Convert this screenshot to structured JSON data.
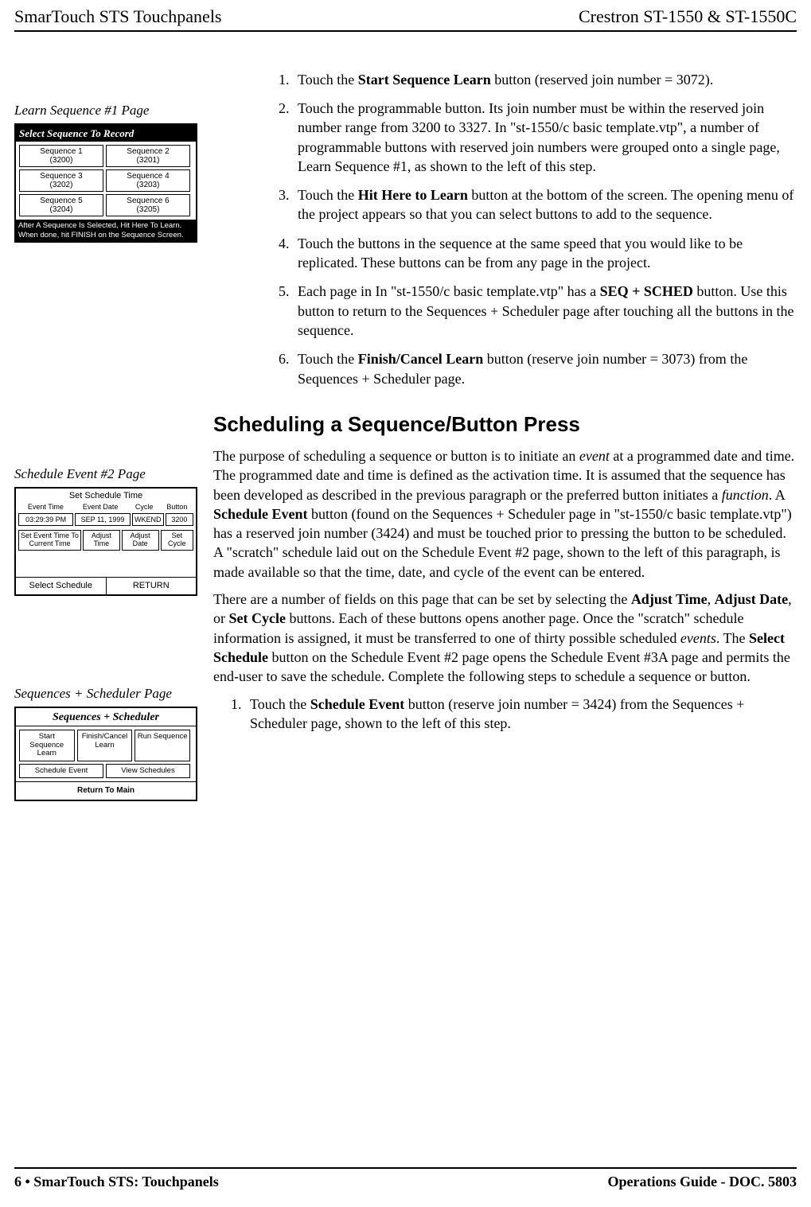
{
  "header": {
    "left": "SmarTouch STS Touchpanels",
    "right_prefix": "Crestron ",
    "right_bold": "ST-1550 & ST-1550C"
  },
  "footer": {
    "left": "6  •  SmarTouch STS: Touchpanels",
    "right": "Operations Guide - DOC. 5803"
  },
  "sidebar": {
    "fig1_caption": "Learn Sequence #1 Page",
    "fig2_caption": "Schedule Event #2 Page",
    "fig3_caption": "Sequences + Scheduler Page"
  },
  "fig1": {
    "title": "Select Sequence To Record",
    "cells": [
      {
        "name": "Sequence 1",
        "num": "(3200)"
      },
      {
        "name": "Sequence 2",
        "num": "(3201)"
      },
      {
        "name": "Sequence 3",
        "num": "(3202)"
      },
      {
        "name": "Sequence 4",
        "num": "(3203)"
      },
      {
        "name": "Sequence 5",
        "num": "(3204)"
      },
      {
        "name": "Sequence 6",
        "num": "(3205)"
      }
    ],
    "foot1": "After A Sequence Is Selected, Hit Here To Learn.",
    "foot2": "When done, hit FINISH on the Sequence Screen."
  },
  "fig2": {
    "head": "Set Schedule Time",
    "cols": [
      "Event Time",
      "Event Date",
      "Cycle",
      "Button"
    ],
    "row": [
      "03:29:39 PM",
      "SEP 11, 1999",
      "WKEND",
      "3200"
    ],
    "btns": [
      "Set Event Time To Current Time",
      "Adjust Time",
      "Adjust Date",
      "Set Cycle"
    ],
    "foot_left": "Select Schedule",
    "foot_right": "RETURN"
  },
  "fig3": {
    "title": "Sequences + Scheduler",
    "row1": [
      "Start Sequence Learn",
      "Finish/Cancel Learn",
      "Run Sequence"
    ],
    "row2": [
      "Schedule Event",
      "View Schedules"
    ],
    "foot": "Return To Main"
  },
  "steps_a": {
    "s1a": "Touch the ",
    "s1b": "Start Sequence Learn",
    "s1c": " button (reserved join number = 3072).",
    "s2": "Touch the programmable button. Its join number must be within the reserved join number range from 3200 to 3327. In \"st-1550/c basic template.vtp\", a number of programmable buttons with reserved join numbers were grouped onto a single page, Learn Sequence #1, as shown to the left of this step.",
    "s3a": "Touch the ",
    "s3b": "Hit Here to Learn",
    "s3c": " button at the bottom of the screen. The opening menu of the project appears so that you can select buttons to add to the sequence.",
    "s4": "Touch the buttons in the sequence at the same speed that you would like to be replicated. These buttons can be from any page in the project.",
    "s5a": "Each page in In \"st-1550/c basic template.vtp\" has a ",
    "s5b": "SEQ + SCHED",
    "s5c": " button. Use this button to return to the Sequences + Scheduler page after touching all the buttons in the sequence.",
    "s6a": "Touch the ",
    "s6b": "Finish/Cancel Learn",
    "s6c": " button (reserve join number = 3073) from the Sequences + Scheduler page."
  },
  "section2": {
    "title": "Scheduling a Sequence/Button Press",
    "p1a": "The purpose of scheduling a sequence or button is to initiate an ",
    "p1b": "event",
    "p1c": " at a programmed date and time. The programmed date and time is defined as the activation time. It is assumed that the sequence has been developed as described in the previous paragraph or the preferred button initiates a ",
    "p1d": "function",
    "p1e": ". A ",
    "p1f": "Schedule Event",
    "p1g": " button (found on the Sequences + Scheduler page in \"st-1550/c basic template.vtp\") has a reserved join number (3424) and must be touched prior to pressing the button to be scheduled. A \"scratch\" schedule laid out on the Schedule Event #2 page, shown to the left of this paragraph, is made available so that the time, date, and cycle of the event can be entered.",
    "p2a": "There are a number of fields on this page that can be set by selecting the ",
    "p2b": "Adjust Time",
    "p2c": ", ",
    "p2d": "Adjust Date",
    "p2e": ", or ",
    "p2f": "Set Cycle",
    "p2g": " buttons. Each of these buttons opens another page. Once the \"scratch\" schedule information is assigned, it must be transferred to one of thirty possible scheduled ",
    "p2h": "events",
    "p2i": ". The ",
    "p2j": "Select Schedule",
    "p2k": " button on the Schedule Event #2 page opens the Schedule Event #3A page and permits the end-user to save the schedule. Complete the following steps to schedule a sequence or button.",
    "step1a": "Touch the ",
    "step1b": "Schedule Event",
    "step1c": " button (reserve join number = 3424) from the Sequences + Scheduler page, shown to the left of this step."
  }
}
